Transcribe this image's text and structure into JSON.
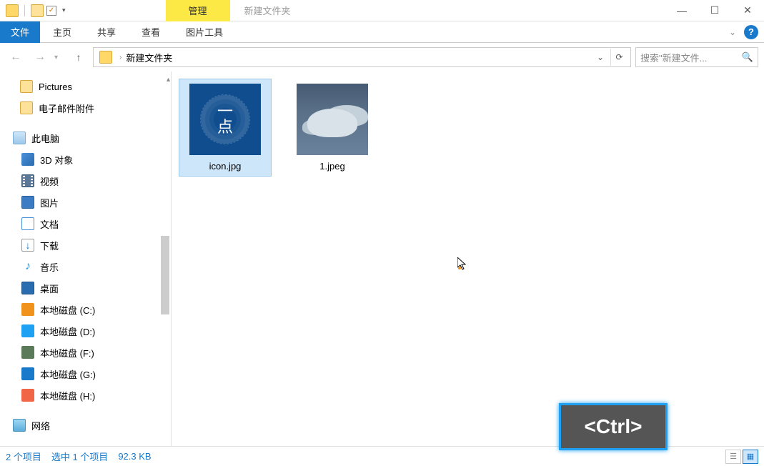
{
  "titlebar": {
    "manage_tab": "管理",
    "window_title": "新建文件夹"
  },
  "ribbon": {
    "file": "文件",
    "home": "主页",
    "share": "共享",
    "view": "查看",
    "pictools": "图片工具"
  },
  "addressbar": {
    "crumb": "新建文件夹"
  },
  "search": {
    "placeholder": "搜索\"新建文件..."
  },
  "sidebar": {
    "pictures": "Pictures",
    "email": "电子邮件附件",
    "thispc": "此电脑",
    "objects3d": "3D 对象",
    "videos": "视频",
    "images": "图片",
    "documents": "文档",
    "downloads": "下载",
    "music": "音乐",
    "desktop": "桌面",
    "drive_c": "本地磁盘 (C:)",
    "drive_d": "本地磁盘 (D:)",
    "drive_f": "本地磁盘 (F:)",
    "drive_g": "本地磁盘 (G:)",
    "drive_h": "本地磁盘 (H:)",
    "network": "网络"
  },
  "files": {
    "item1_name": "icon.jpg",
    "item1_text_top": "一",
    "item1_text_bottom": "点",
    "item2_name": "1.jpeg"
  },
  "statusbar": {
    "count": "2 个项目",
    "selected": "选中 1 个项目",
    "size": "92.3 KB"
  },
  "overlay": {
    "ctrl": "<Ctrl>"
  }
}
